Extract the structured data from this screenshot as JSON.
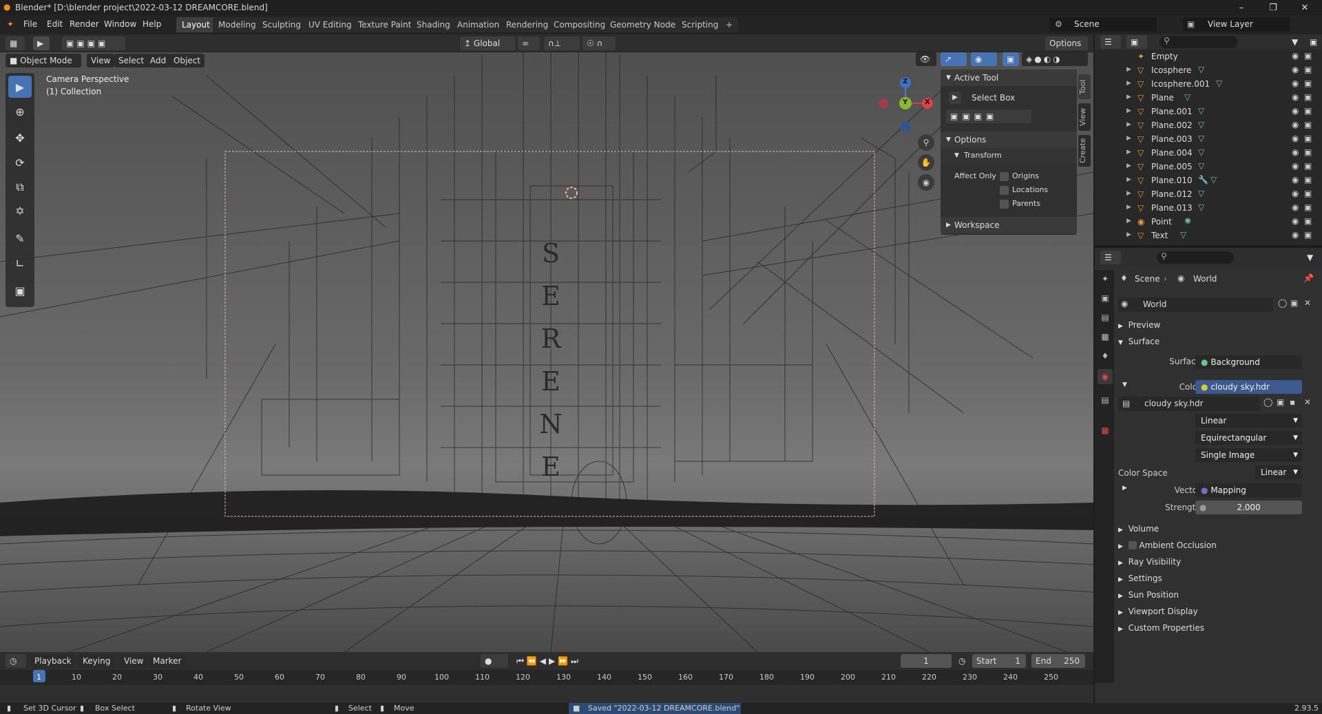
{
  "title_bar": {
    "title": "Blender* [D:\\blender project\\2022-03-12 DREAMCORE.blend]",
    "minimize": "–",
    "maximize": "❒",
    "close": "✕"
  },
  "menu": {
    "items": [
      "File",
      "Edit",
      "Render",
      "Window",
      "Help"
    ]
  },
  "workspaces": {
    "tabs": [
      "Layout",
      "Modeling",
      "Sculpting",
      "UV Editing",
      "Texture Paint",
      "Shading",
      "Animation",
      "Rendering",
      "Compositing",
      "Geometry Nodes",
      "Scripting"
    ],
    "active": "Layout",
    "add": "+"
  },
  "scene_selector": {
    "scene": "Scene",
    "view_layer": "View Layer"
  },
  "viewport_header": {
    "mode": "Object Mode",
    "menus": [
      "View",
      "Select",
      "Add",
      "Object"
    ],
    "orientation": "Global",
    "options": "Options"
  },
  "viewport": {
    "overlay_line1": "Camera Perspective",
    "overlay_line2": "(1) Collection",
    "serene_letters": [
      "S",
      "E",
      "R",
      "E",
      "N",
      "E"
    ],
    "gizmo": {
      "x": "X",
      "y": "Y",
      "z": "Z"
    }
  },
  "n_panel": {
    "active_tool_header": "Active Tool",
    "tool_name": "Select Box",
    "options_header": "Options",
    "transform_header": "Transform",
    "affect_only": "Affect Only",
    "checks": [
      "Origins",
      "Locations",
      "Parents"
    ],
    "workspace_header": "Workspace",
    "side_tabs": [
      "Tool",
      "View",
      "Create"
    ]
  },
  "outliner": {
    "items": [
      {
        "name": "Empty"
      },
      {
        "name": "Icosphere"
      },
      {
        "name": "Icosphere.001"
      },
      {
        "name": "Plane"
      },
      {
        "name": "Plane.001"
      },
      {
        "name": "Plane.002"
      },
      {
        "name": "Plane.003"
      },
      {
        "name": "Plane.004"
      },
      {
        "name": "Plane.005"
      },
      {
        "name": "Plane.010"
      },
      {
        "name": "Plane.012"
      },
      {
        "name": "Plane.013"
      },
      {
        "name": "Point"
      },
      {
        "name": "Text"
      }
    ]
  },
  "properties": {
    "breadcrumb": {
      "scene": "Scene",
      "sep": "›",
      "world": "World"
    },
    "world_name": "World",
    "preview": "Preview",
    "surface_header": "Surface",
    "surface_label": "Surface",
    "surface_value": "Background",
    "color_label": "Color",
    "color_value": "cloudy sky.hdr",
    "image_name": "cloudy sky.hdr",
    "interp": "Linear",
    "projection": "Equirectangular",
    "source": "Single Image",
    "color_space_label": "Color Space",
    "color_space_value": "Linear",
    "vector_label": "Vector",
    "vector_value": "Mapping",
    "strength_label": "Strength",
    "strength_value": "2.000",
    "collapsed_sections": [
      "Volume",
      "Ambient Occlusion",
      "Ray Visibility",
      "Settings",
      "Sun Position",
      "Viewport Display",
      "Custom Properties"
    ]
  },
  "timeline": {
    "menus": [
      "Playback",
      "Keying",
      "View",
      "Marker"
    ],
    "current_frame": "1",
    "start_label": "Start",
    "start_value": "1",
    "end_label": "End",
    "end_value": "250",
    "ticks": [
      "1",
      "10",
      "20",
      "30",
      "40",
      "50",
      "60",
      "70",
      "80",
      "90",
      "100",
      "110",
      "120",
      "130",
      "140",
      "150",
      "160",
      "170",
      "180",
      "190",
      "200",
      "210",
      "220",
      "230",
      "240",
      "250"
    ]
  },
  "status_bar": {
    "hint1": "Set 3D Cursor",
    "hint2": "Box Select",
    "hint3": "Rotate View",
    "hint4": "Select",
    "hint5": "Move",
    "saved": "Saved \"2022-03-12 DREAMCORE.blend\"",
    "version": "2.93.5"
  },
  "colors": {
    "accent": "#4772b3",
    "object_orange": "#e69a3b",
    "mesh_green": "#6fc19e"
  }
}
